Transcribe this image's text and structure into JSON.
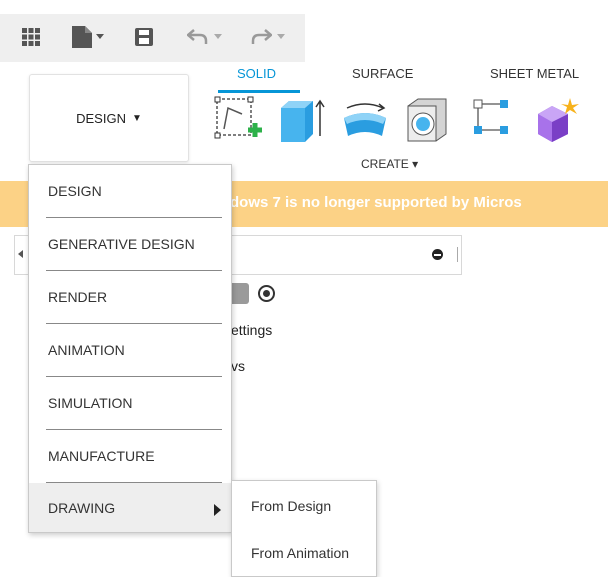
{
  "quick_access": {
    "icons": [
      "grid-icon",
      "file-icon",
      "save-icon",
      "undo-icon",
      "redo-icon"
    ]
  },
  "workspace": {
    "label": "DESIGN",
    "caret": "▼"
  },
  "toolbar": {
    "tabs": [
      {
        "label": "SOLID",
        "active": true
      },
      {
        "label": "SURFACE",
        "active": false
      },
      {
        "label": "SHEET METAL",
        "active": false
      }
    ],
    "tools": [
      "create-sketch-icon",
      "extrude-icon",
      "revolve-icon",
      "hole-icon",
      "pattern-icon",
      "new-component-icon"
    ],
    "create_label": "CREATE ▾"
  },
  "banner": {
    "text": "dows 7 is no longer supported by Micros"
  },
  "background": {
    "settings_text": "ettings",
    "views_text": "vs"
  },
  "menu": {
    "items": [
      {
        "label": "DESIGN"
      },
      {
        "label": "GENERATIVE DESIGN"
      },
      {
        "label": "RENDER"
      },
      {
        "label": "ANIMATION"
      },
      {
        "label": "SIMULATION"
      },
      {
        "label": "MANUFACTURE"
      },
      {
        "label": "DRAWING",
        "has_submenu": true,
        "highlighted": true
      }
    ]
  },
  "submenu": {
    "items": [
      {
        "label": "From Design"
      },
      {
        "label": "From Animation"
      }
    ]
  },
  "colors": {
    "accent": "#0696d7",
    "banner": "#fcd286",
    "menu_hover": "#eeeeee"
  }
}
